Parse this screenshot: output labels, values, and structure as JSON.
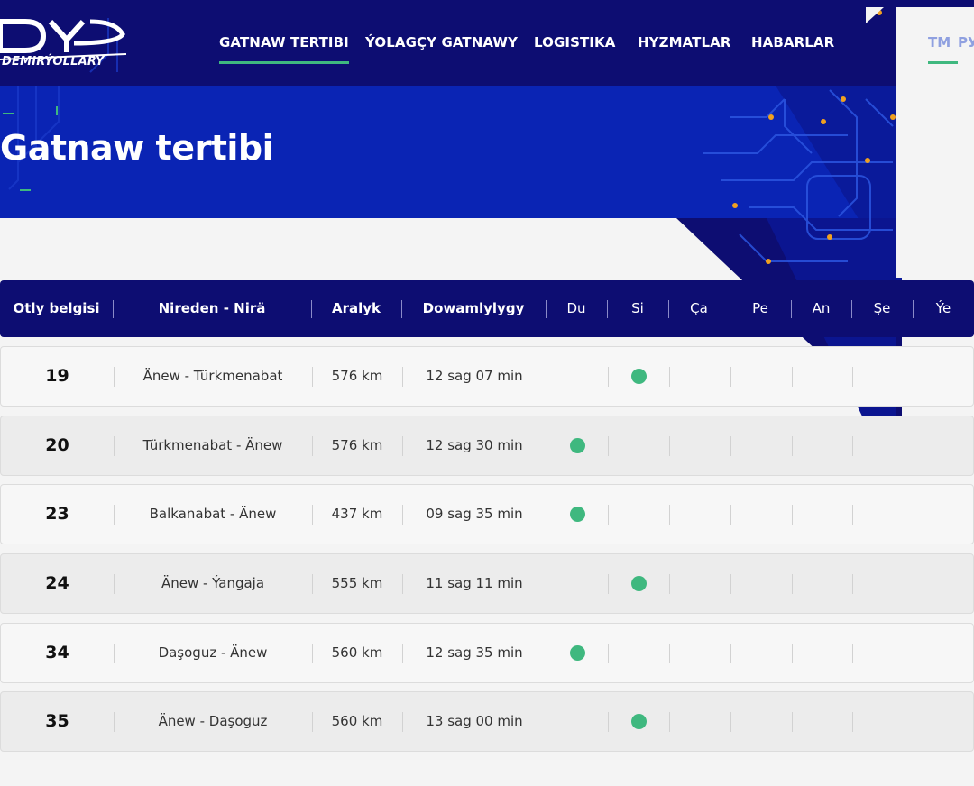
{
  "brand": {
    "logo_text": "DEMIRÝOLLARY"
  },
  "nav": {
    "items": [
      {
        "label": "GATNAW TERTIBI",
        "active": true
      },
      {
        "label": "ÝOLAGÇY GATNAWY",
        "active": false
      },
      {
        "label": "LOGISTIKA",
        "active": false
      },
      {
        "label": "HYZMATLAR",
        "active": false
      },
      {
        "label": "HABARLAR",
        "active": false
      }
    ],
    "languages": [
      {
        "label": "TM",
        "active": true
      },
      {
        "label": "РУ",
        "active": false
      }
    ]
  },
  "page": {
    "title": "Gatnaw tertibi"
  },
  "table": {
    "headers": {
      "train": "Otly belgisi",
      "route": "Nireden - Nirä",
      "distance": "Aralyk",
      "duration": "Dowamlylygy",
      "days": [
        "Du",
        "Si",
        "Ça",
        "Pe",
        "An",
        "Şe",
        "Ýe"
      ]
    },
    "rows": [
      {
        "train": "19",
        "route": "Änew - Türkmenabat",
        "distance": "576 km",
        "duration": "12 sag 07 min",
        "days": [
          false,
          true,
          false,
          false,
          false,
          false,
          false
        ]
      },
      {
        "train": "20",
        "route": "Türkmenabat - Änew",
        "distance": "576 km",
        "duration": "12 sag 30 min",
        "days": [
          true,
          false,
          false,
          false,
          false,
          false,
          false
        ]
      },
      {
        "train": "23",
        "route": "Balkanabat - Änew",
        "distance": "437 km",
        "duration": "09 sag 35 min",
        "days": [
          true,
          false,
          false,
          false,
          false,
          false,
          false
        ]
      },
      {
        "train": "24",
        "route": "Änew - Ýangaja",
        "distance": "555 km",
        "duration": "11 sag 11 min",
        "days": [
          false,
          true,
          false,
          false,
          false,
          false,
          false
        ]
      },
      {
        "train": "34",
        "route": "Daşoguz - Änew",
        "distance": "560 km",
        "duration": "12 sag 35 min",
        "days": [
          true,
          false,
          false,
          false,
          false,
          false,
          false
        ]
      },
      {
        "train": "35",
        "route": "Änew - Daşoguz",
        "distance": "560 km",
        "duration": "13 sag 00 min",
        "days": [
          false,
          true,
          false,
          false,
          false,
          false,
          false
        ]
      }
    ]
  },
  "colors": {
    "header_navy": "#0d0d72",
    "hero_blue": "#0a24b4",
    "accent_green": "#3fb87f",
    "circuit_dot": "#f0a020"
  }
}
